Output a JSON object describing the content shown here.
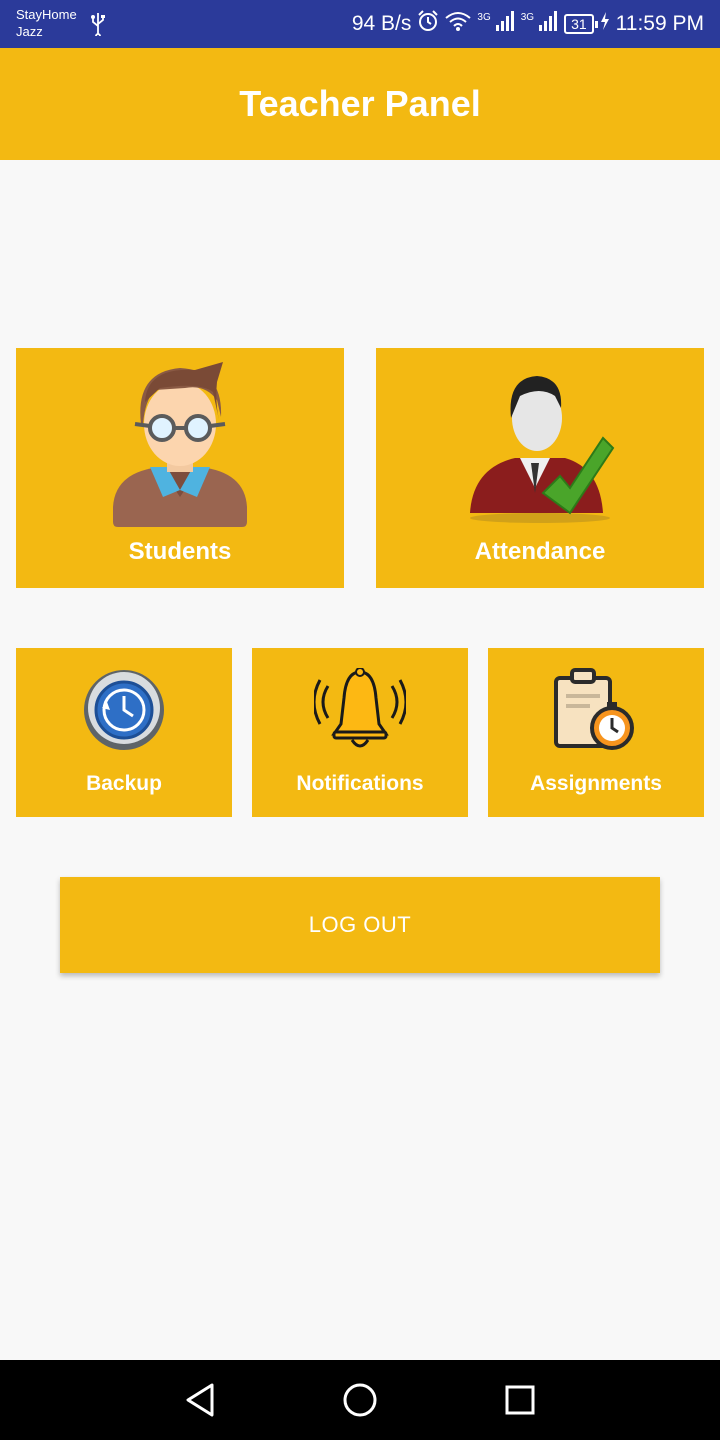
{
  "status_bar": {
    "carrier_line1": "StayHome",
    "carrier_line2": "Jazz",
    "network_speed": "94 B/s",
    "signal1_label": "3G",
    "signal2_label": "3G",
    "battery": "31",
    "time": "11:59 PM"
  },
  "app_bar": {
    "title": "Teacher Panel"
  },
  "tiles": {
    "students": {
      "label": "Students",
      "icon": "student-avatar-icon"
    },
    "attendance": {
      "label": "Attendance",
      "icon": "attendance-check-icon"
    },
    "backup": {
      "label": "Backup",
      "icon": "backup-clock-icon"
    },
    "notifications": {
      "label": "Notifications",
      "icon": "bell-icon"
    },
    "assignments": {
      "label": "Assignments",
      "icon": "clipboard-stopwatch-icon"
    }
  },
  "logout": {
    "label": "LOG OUT"
  },
  "colors": {
    "accent": "#f3b912",
    "status_bar": "#2b3a9a",
    "background": "#f8f8f8"
  }
}
